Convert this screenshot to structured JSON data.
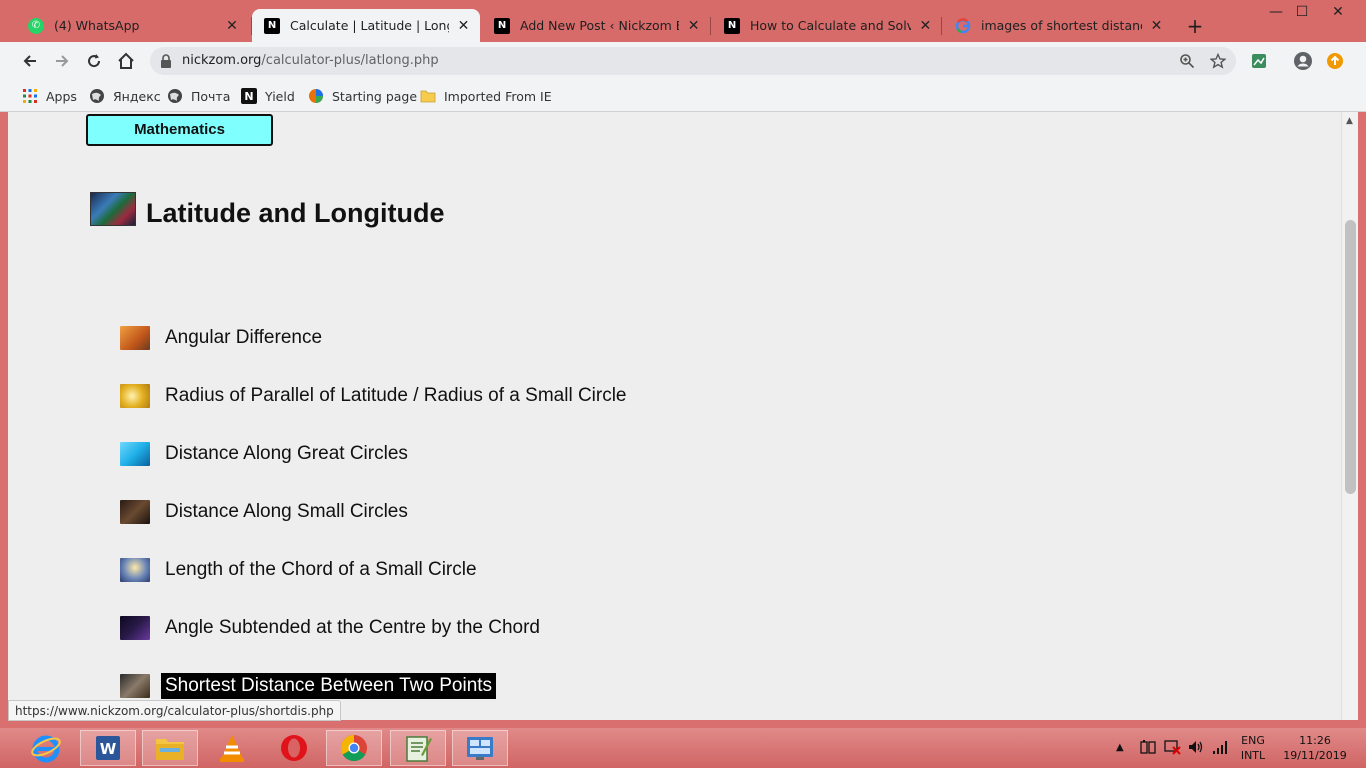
{
  "browser": {
    "tabs": [
      {
        "title": "(4) WhatsApp",
        "icon": "whatsapp-icon",
        "active": false
      },
      {
        "title": "Calculate | Latitude | Longitude",
        "icon": "nickzom-icon",
        "active": true
      },
      {
        "title": "Add New Post ‹ Nickzom Blog —",
        "icon": "nickzom-icon",
        "active": false
      },
      {
        "title": "How to Calculate and Solve for",
        "icon": "nickzom-icon",
        "active": false
      },
      {
        "title": "images of shortest distance bet",
        "icon": "google-icon",
        "active": false
      }
    ],
    "url_host": "nickzom.org",
    "url_path": "/calculator-plus/latlong.php",
    "bookmarks": [
      {
        "label": "Apps",
        "icon": "apps-grid-icon"
      },
      {
        "label": "Яндекс",
        "icon": "globe-icon"
      },
      {
        "label": "Почта",
        "icon": "globe-icon"
      },
      {
        "label": "Yield",
        "icon": "notion-icon"
      },
      {
        "label": "Starting page",
        "icon": "starting-page-icon"
      },
      {
        "label": "Imported From IE",
        "icon": "folder-icon"
      }
    ],
    "status_url": "https://www.nickzom.org/calculator-plus/shortdis.php"
  },
  "page": {
    "category_button": "Mathematics",
    "title": "Latitude and Longitude",
    "links": [
      {
        "label": "Angular Difference",
        "thumb": "#e58a2c"
      },
      {
        "label": "Radius of Parallel of Latitude / Radius of a Small Circle",
        "thumb": "#e3b022"
      },
      {
        "label": "Distance Along Great Circles",
        "thumb": "#1fb0e8"
      },
      {
        "label": "Distance Along Small Circles",
        "thumb": "#3b2a22"
      },
      {
        "label": "Length of the Chord of a Small Circle",
        "thumb": "#6a86b8"
      },
      {
        "label": "Angle Subtended at the Centre by the Chord",
        "thumb": "#2a1a4a"
      },
      {
        "label": "Shortest Distance Between Two Points",
        "thumb": "#5a4a3a"
      }
    ],
    "highlight_color": "#000000",
    "category_color": "#80ffff"
  },
  "taskbar": {
    "apps": [
      "internet-explorer-icon",
      "word-icon",
      "file-explorer-icon",
      "vlc-icon",
      "opera-icon",
      "chrome-icon",
      "notepad-icon",
      "control-panel-icon"
    ],
    "lang": "ENG",
    "layout": "INTL",
    "time": "11:26",
    "date": "19/11/2019"
  }
}
